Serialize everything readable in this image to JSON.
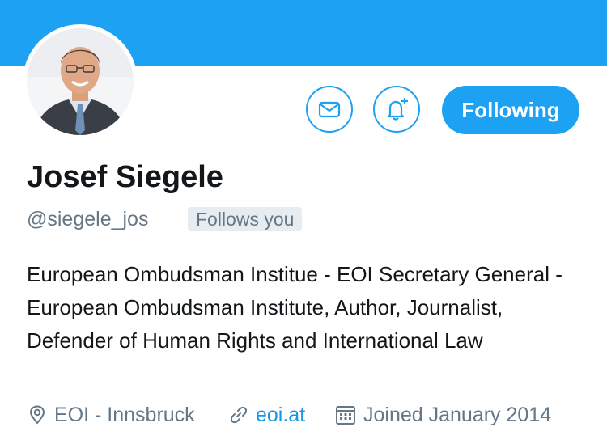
{
  "profile": {
    "name": "Josef Siegele",
    "handle": "@siegele_jos",
    "follows_you_badge": "Follows you",
    "bio": "European Ombudsman Institue - EOI Secretary General - European Ombudsman Institute, Author, Journalist, Defender of Human Rights and International Law",
    "location": "EOI - Innsbruck",
    "website": "eoi.at",
    "joined": "Joined January 2014"
  },
  "actions": {
    "follow_label": "Following",
    "message_icon": "envelope-icon",
    "notify_icon": "bell-plus-icon"
  },
  "colors": {
    "accent": "#1da1f2",
    "secondary_text": "#657786",
    "link": "#1b95e0",
    "primary_text": "#14171a"
  }
}
